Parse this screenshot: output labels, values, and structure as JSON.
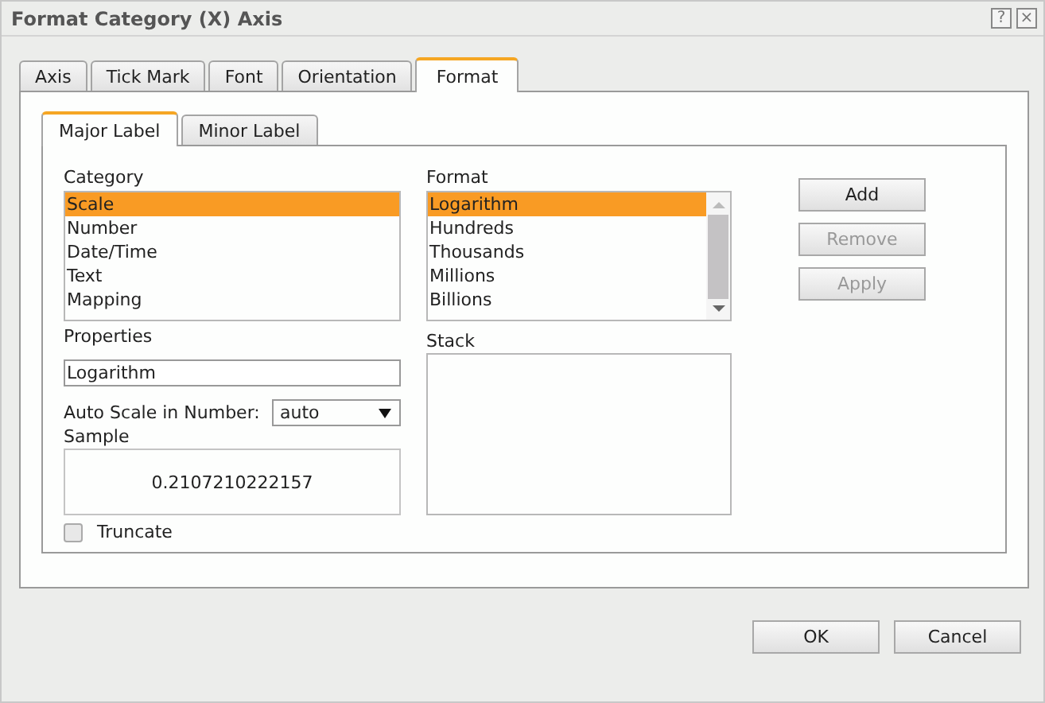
{
  "window": {
    "title": "Format Category (X) Axis",
    "controls": [
      "?",
      "×"
    ]
  },
  "tabs": [
    {
      "label": "Axis",
      "selected": false
    },
    {
      "label": "Tick Mark",
      "selected": false
    },
    {
      "label": "Font",
      "selected": false
    },
    {
      "label": "Orientation",
      "selected": false
    },
    {
      "label": "Format",
      "selected": true
    }
  ],
  "subtabs": [
    {
      "label": "Major Label",
      "selected": true
    },
    {
      "label": "Minor Label",
      "selected": false
    }
  ],
  "category": {
    "label": "Category",
    "items": [
      {
        "label": "Scale",
        "selected": true
      },
      {
        "label": "Number",
        "selected": false
      },
      {
        "label": "Date/Time",
        "selected": false
      },
      {
        "label": "Text",
        "selected": false
      },
      {
        "label": "Mapping",
        "selected": false
      }
    ]
  },
  "properties": {
    "label": "Properties",
    "value": "Logarithm"
  },
  "auto_scale": {
    "label": "Auto Scale in Number:",
    "value": "auto"
  },
  "sample": {
    "label": "Sample",
    "value": "0.2107210222157"
  },
  "truncate": {
    "label": "Truncate",
    "checked": false
  },
  "format": {
    "label": "Format",
    "items": [
      {
        "label": "Logarithm",
        "selected": true
      },
      {
        "label": "Hundreds",
        "selected": false
      },
      {
        "label": "Thousands",
        "selected": false
      },
      {
        "label": "Millions",
        "selected": false
      },
      {
        "label": "Billions",
        "selected": false
      }
    ]
  },
  "stack": {
    "label": "Stack"
  },
  "side_buttons": [
    {
      "label": "Add",
      "disabled": false
    },
    {
      "label": "Remove",
      "disabled": true
    },
    {
      "label": "Apply",
      "disabled": true
    }
  ],
  "buttons": [
    "OK",
    "Cancel"
  ]
}
